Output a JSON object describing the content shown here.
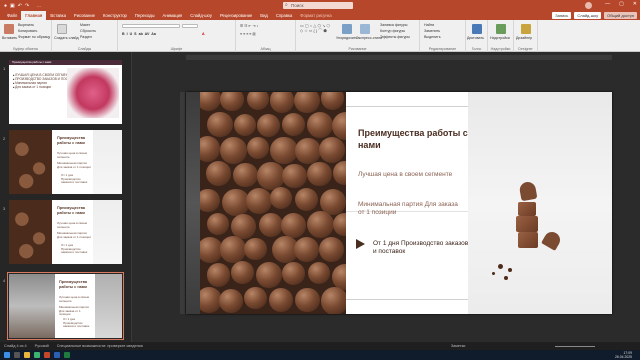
{
  "titlebar": {
    "doc_title": "...",
    "search_placeholder": "Поиск",
    "win_min": "—",
    "win_max": "▢",
    "win_close": "✕"
  },
  "tabs": [
    {
      "label": "Файл"
    },
    {
      "label": "Главная"
    },
    {
      "label": "Вставка"
    },
    {
      "label": "Рисование"
    },
    {
      "label": "Конструктор"
    },
    {
      "label": "Переходы"
    },
    {
      "label": "Анимация"
    },
    {
      "label": "Слайд-шоу"
    },
    {
      "label": "Рецензирование"
    },
    {
      "label": "Вид"
    },
    {
      "label": "Справка"
    },
    {
      "label": "Формат рисунка"
    }
  ],
  "tab_buttons": {
    "comments": "Запись",
    "present": "Слайд-шоу",
    "share": "Общий доступ"
  },
  "ribbon": {
    "groups": [
      "Буфер обмена",
      "Слайды",
      "Шрифт",
      "Абзац",
      "Рисование",
      "Редактирование",
      "Голос",
      "Надстройки",
      "Designer"
    ],
    "paste_label": "Вставить",
    "cut_label": "Вырезать",
    "copy_label": "Копировать",
    "format_label": "Формат по образцу",
    "new_slide_label": "Создать слайд",
    "layout_label": "Макет",
    "reset_label": "Сбросить",
    "section_label": "Раздел",
    "find_label": "Найти",
    "replace_label": "Заменить",
    "select_label": "Выделить",
    "dictate_label": "Диктовать",
    "addins_label": "Надстройки",
    "designer_label": "Дизайнер",
    "arrange_label": "Упорядочить",
    "quick_styles_label": "Экспресс-стили",
    "fill_label": "Заливка фигуры",
    "outline_label": "Контур фигуры",
    "effects_label": "Эффекты фигуры"
  },
  "thumbs": {
    "nums": [
      "1",
      "2",
      "3",
      "4"
    ],
    "t1": {
      "band": "Преимущества работы с нами",
      "items": [
        "ЛУЧШАЯ ЦЕНА В СВОЕМ СЕГМЕНТЕ",
        "ПРОИЗВОДСТВО ЗАКАЗОВ И ПОСТАВОК - ОТ 1 ДНЯ",
        "Минимальная партия",
        "Для заказа от 1 позиции"
      ]
    },
    "t2": {
      "title": "Преимущества работы с нами",
      "l1": "Лучшая цена в своем сегменте",
      "l2": "Минимальная партия Для заказа от 1 позиции",
      "l3": "От 1 дня Производство заказов и поставок"
    },
    "t3": {
      "title": "Преимущества работы с нами",
      "l1": "Лучшая цена в своем сегменте",
      "l2": "Минимальная партия Для заказа от 1 позиции",
      "l3": "От 1 дня Производство заказов и поставок"
    },
    "t4": {
      "title": "Преимущества работы с нами",
      "l1": "Лучшая цена в своем сегменте",
      "l2": "Минимальная партия Для заказа от 1 позиции",
      "l3": "От 1 дня Производство заказов и поставок"
    }
  },
  "slide": {
    "title": "Преимущества работы с нами",
    "line1": "Лучшая цена в своем сегменте",
    "line2": "Минимальная партия Для заказа от 1 позиции",
    "line3": "От 1 дня Производство заказов и поставок"
  },
  "status": {
    "slide_info": "Слайд 4 из 4",
    "language": "Русский",
    "accessibility": "Специальные возможности: проверьте сведения",
    "notes": "Заметки"
  },
  "taskbar": {
    "time": "17:09",
    "date": "26.04.2025",
    "lang": "РУС"
  },
  "colors": {
    "accent": "#b7472a",
    "brand_dark": "#4a2d21",
    "text_light": "#8a6252"
  }
}
